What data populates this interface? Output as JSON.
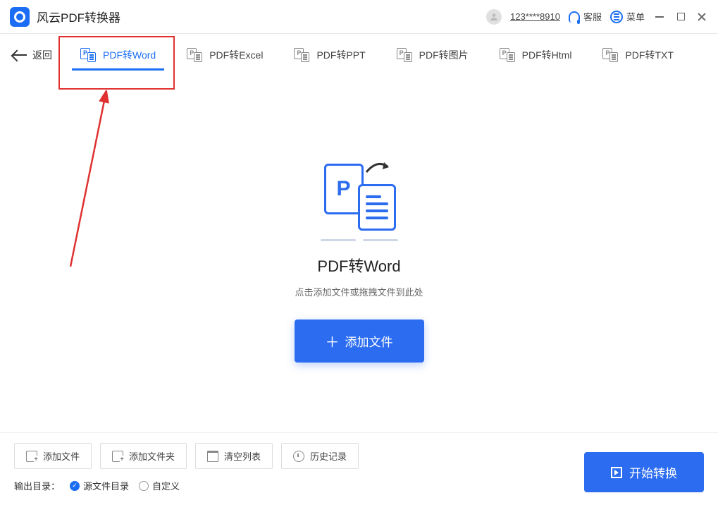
{
  "titlebar": {
    "app_name": "风云PDF转换器",
    "user": "123****8910",
    "support": "客服",
    "menu": "菜单"
  },
  "tabs": {
    "back": "返回",
    "items": [
      {
        "label": "PDF转Word"
      },
      {
        "label": "PDF转Excel"
      },
      {
        "label": "PDF转PPT"
      },
      {
        "label": "PDF转图片"
      },
      {
        "label": "PDF转Html"
      },
      {
        "label": "PDF转TXT"
      }
    ]
  },
  "main": {
    "title": "PDF转Word",
    "hint": "点击添加文件或拖拽文件到此处",
    "add_button": "添加文件"
  },
  "bottom": {
    "buttons": {
      "add_file": "添加文件",
      "add_folder": "添加文件夹",
      "clear_list": "清空列表",
      "history": "历史记录"
    },
    "output_label": "输出目录：",
    "radio_source": "源文件目录",
    "radio_custom": "自定义",
    "start": "开始转换"
  }
}
